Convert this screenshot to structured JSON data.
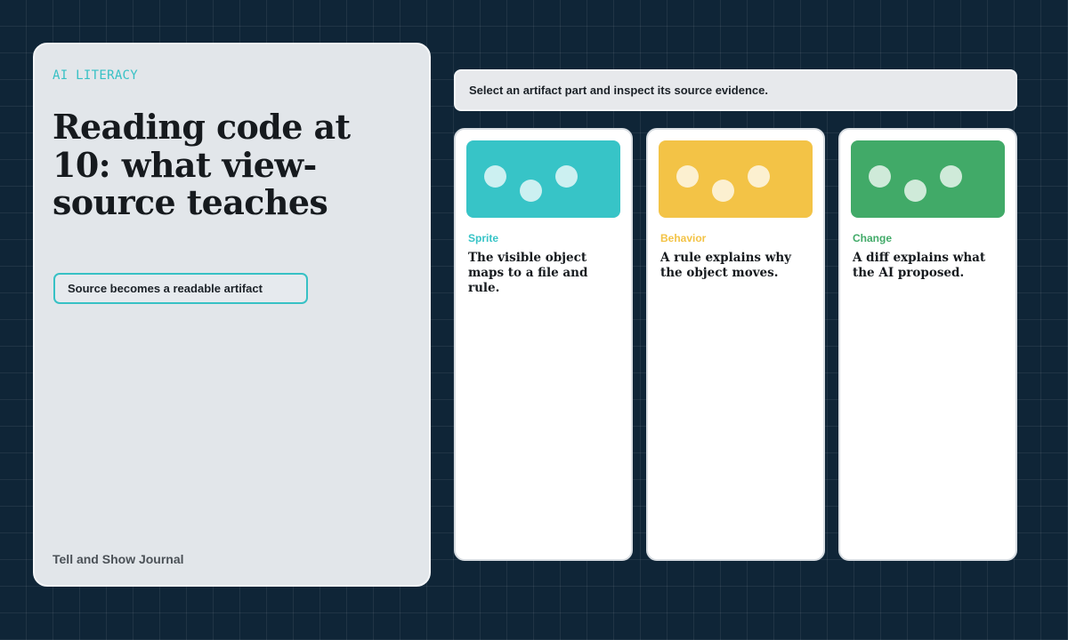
{
  "hero": {
    "kicker": "AI LITERACY",
    "title": "Reading code at 10: what view-source teaches",
    "pill_label": "Source becomes a readable artifact",
    "footer": "Tell and Show Journal"
  },
  "instruction": "Select an artifact part and inspect its source evidence.",
  "cards": [
    {
      "label": "Sprite",
      "description": "The visible object maps to a file and rule.",
      "color": "#37c4c7"
    },
    {
      "label": "Behavior",
      "description": "A rule explains why the object moves.",
      "color": "#f3c346"
    },
    {
      "label": "Change",
      "description": "A diff explains what the AI proposed.",
      "color": "#41aa68"
    }
  ]
}
